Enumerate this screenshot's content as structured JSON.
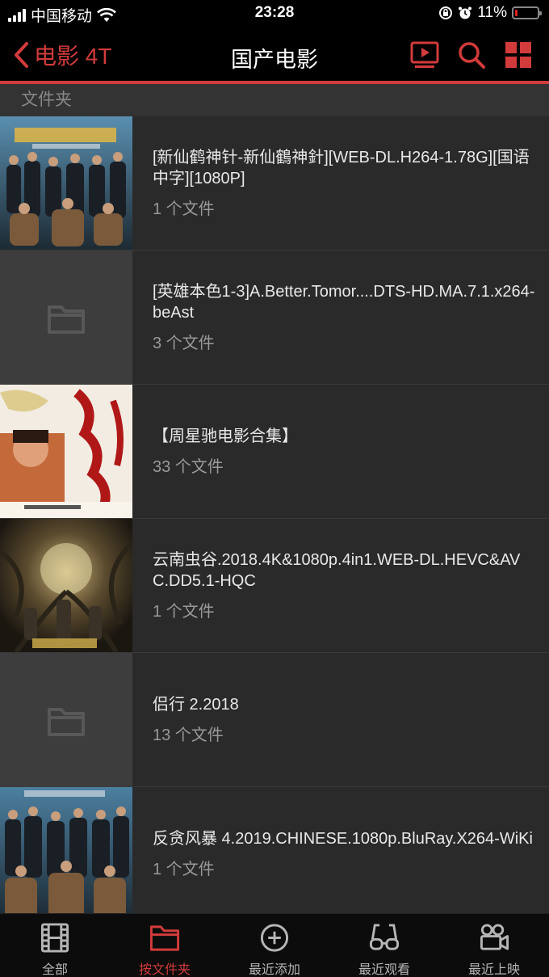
{
  "status_bar": {
    "carrier": "中国移动",
    "time": "23:28",
    "battery": "11%",
    "battery_level": 0.11
  },
  "nav": {
    "back_label": "电影 4T",
    "title": "国产电影",
    "actions": [
      "tv-play-icon",
      "search-icon",
      "grid-icon"
    ],
    "accent_color": "#d23b3b"
  },
  "section_header": "文件夹",
  "folders": [
    {
      "title": "[新仙鹤神针-新仙鶴神針][WEB-DL.H264-1.78G][国语中字][1080P]",
      "count": "1 个文件",
      "thumb": "poster-storm"
    },
    {
      "title": "[英雄本色1-3]A.Better.Tomor....DTS-HD.MA.7.1.x264-beAst",
      "count": "3 个文件",
      "thumb": "folder-placeholder"
    },
    {
      "title": "【周星驰电影合集】",
      "count": "33 个文件",
      "thumb": "poster-dragon"
    },
    {
      "title": "云南虫谷.2018.4K&1080p.4in1.WEB-DL.HEVC&AVC.DD5.1-HQC",
      "count": "1 个文件",
      "thumb": "poster-yunnan"
    },
    {
      "title": "侣行 2.2018",
      "count": "13 个文件",
      "thumb": "folder-placeholder"
    },
    {
      "title": "反贪风暴 4.2019.CHINESE.1080p.BluRay.X264-WiKi",
      "count": "1 个文件",
      "thumb": "poster-storm"
    }
  ],
  "tabs": [
    {
      "label": "全部",
      "icon": "film-icon",
      "active": false
    },
    {
      "label": "按文件夹",
      "icon": "folder-icon",
      "active": true
    },
    {
      "label": "最近添加",
      "icon": "plus-circle-icon",
      "active": false
    },
    {
      "label": "最近观看",
      "icon": "glasses-icon",
      "active": false
    },
    {
      "label": "最近上映",
      "icon": "camera-icon",
      "active": false
    }
  ]
}
